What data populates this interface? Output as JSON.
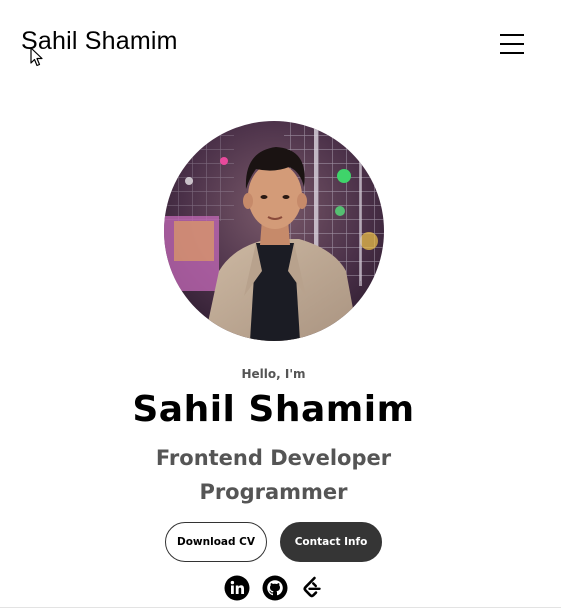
{
  "header": {
    "brand": "Sahil Shamim",
    "menu_icon": "hamburger-menu-icon"
  },
  "profile": {
    "avatar_icon": "profile-photo",
    "greeting": "Hello, I'm",
    "name": "Sahil Shamim",
    "roles": [
      "Frontend Developer",
      "Programmer"
    ]
  },
  "buttons": {
    "download_cv": "Download CV",
    "contact_info": "Contact Info"
  },
  "social": [
    {
      "icon": "linkedin-icon"
    },
    {
      "icon": "github-icon"
    },
    {
      "icon": "leetcode-icon"
    }
  ],
  "colors": {
    "primary_text": "#000000",
    "secondary_text": "#555555",
    "button_dark": "#353535",
    "background": "#ffffff"
  }
}
